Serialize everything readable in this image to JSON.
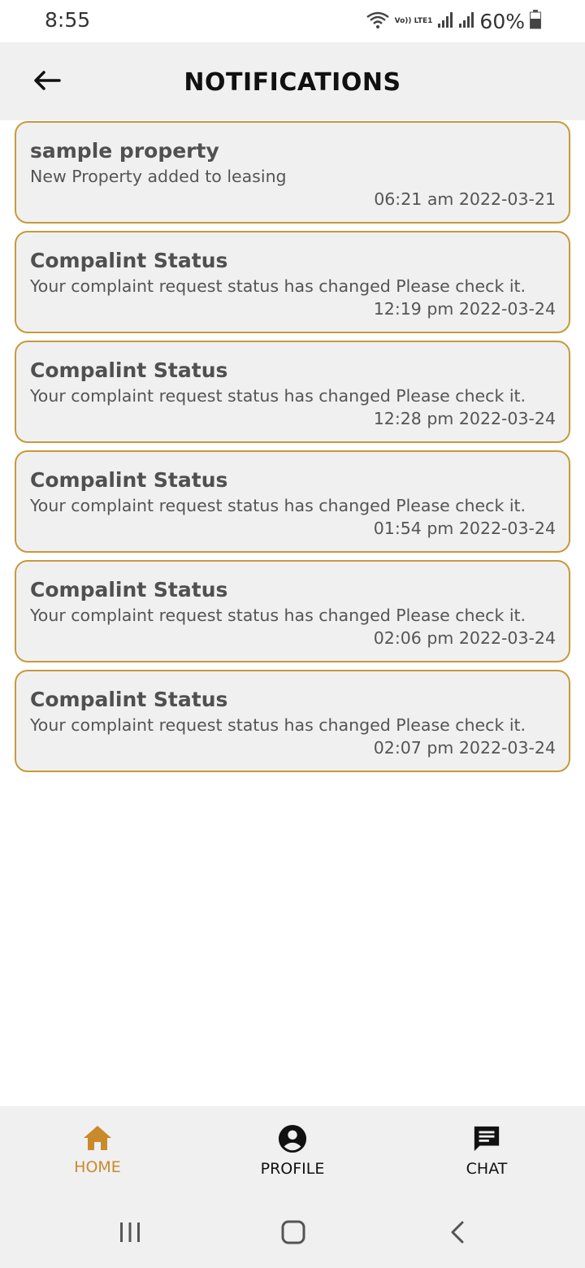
{
  "status_bar": {
    "time": "8:55",
    "network_label": "Vo)) LTE1",
    "battery": "60%"
  },
  "header": {
    "title": "NOTIFICATIONS",
    "back_icon": "arrow-left-icon"
  },
  "notifications": [
    {
      "title": "sample property",
      "message": "New Property added to leasing",
      "time": "06:21 am 2022-03-21"
    },
    {
      "title": "Compalint Status",
      "message": "Your complaint request status has changed Please check it.",
      "time": "12:19 pm 2022-03-24"
    },
    {
      "title": "Compalint Status",
      "message": "Your complaint request status has changed Please check it.",
      "time": "12:28 pm 2022-03-24"
    },
    {
      "title": "Compalint Status",
      "message": "Your complaint request status has changed Please check it.",
      "time": "01:54 pm 2022-03-24"
    },
    {
      "title": "Compalint Status",
      "message": "Your complaint request status has changed Please check it.",
      "time": "02:06 pm 2022-03-24"
    },
    {
      "title": "Compalint Status",
      "message": "Your complaint request status has changed Please check it.",
      "time": "02:07 pm 2022-03-24"
    }
  ],
  "bottom_nav": {
    "home": {
      "label": "HOME",
      "icon": "home-icon",
      "active": true
    },
    "profile": {
      "label": "PROFILE",
      "icon": "account-circle-icon",
      "active": false
    },
    "chat": {
      "label": "CHAT",
      "icon": "chat-icon",
      "active": false
    }
  },
  "colors": {
    "accent": "#c69a3c",
    "active_nav": "#c98a2c",
    "card_background": "#f0f0f0"
  }
}
